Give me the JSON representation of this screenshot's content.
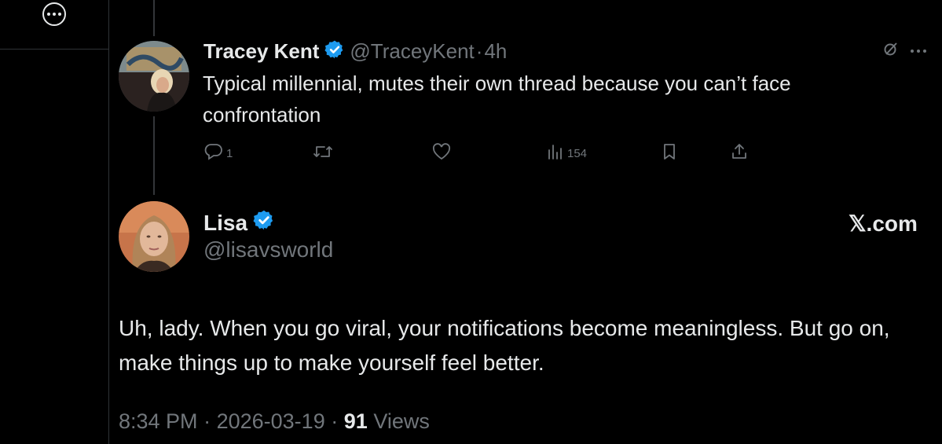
{
  "colors": {
    "background": "#000000",
    "text": "#e7e9ea",
    "muted": "#71767b",
    "verified": "#1d9bf0",
    "separator": "#2f3336"
  },
  "left_rail": {
    "more_icon": "more-circle-icon"
  },
  "tweet1": {
    "name": "Tracey Kent",
    "handle": "@TraceyKent",
    "dot": "·",
    "time": "4h",
    "text": "Typical millennial, mutes their own thread because you can’t face confrontation",
    "reply_count": "1",
    "retweet_count": "",
    "like_count": "",
    "views_count": "154",
    "icons": [
      "grok-icon",
      "more-icon",
      "reply-icon",
      "retweet-icon",
      "like-icon",
      "views-icon",
      "bookmark-icon",
      "share-icon"
    ]
  },
  "tweet2": {
    "name": "Lisa",
    "handle": "@lisavsworld",
    "brand": "𝕏.com",
    "text": "Uh, lady. When you go viral, your notifications become meaningless. But go on, make things up to make yourself feel better.",
    "time": "8:34 PM",
    "date": "2026-03-19",
    "sep": "·",
    "views_count": "91",
    "views_label": "Views"
  }
}
